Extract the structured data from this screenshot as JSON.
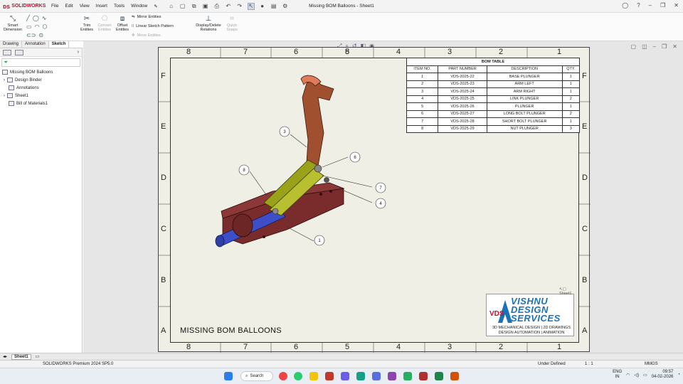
{
  "app": {
    "brand": "SOLIDWORKS",
    "doc_title": "Missing BOM Balloons - Sheet1"
  },
  "menu": [
    "File",
    "Edit",
    "View",
    "Insert",
    "Tools",
    "Window"
  ],
  "ribbon": {
    "smart_dimension": "Smart Dimension",
    "trim": "Trim Entities",
    "convert": "Convert Entities",
    "offset": "Offset Entities",
    "mirror": "Mirror Entities",
    "linear_pattern": "Linear Sketch Pattern",
    "move": "Move Entities",
    "display_delete": "Display/Delete Relations",
    "quick_snaps": "Quick Snaps"
  },
  "tabs": [
    "Drawing",
    "Annotation",
    "Sketch"
  ],
  "tree": {
    "root": "Missing BOM Balloons",
    "items": [
      "Design Binder",
      "Annotations",
      "Sheet1",
      "Bill of Materials1"
    ]
  },
  "sheet": {
    "cols_top": [
      "8",
      "7",
      "6",
      "5",
      "4",
      "3",
      "2",
      "1"
    ],
    "rows": [
      "F",
      "E",
      "D",
      "C",
      "B",
      "A"
    ],
    "title": "MISSING BOM BALLOONS",
    "sheet_label": "Sheet1"
  },
  "bom": {
    "title": "BOM TABLE",
    "headers": [
      "ITEM NO.",
      "PART NUMBER",
      "DESCRIPTION",
      "QTY."
    ],
    "rows": [
      [
        "1",
        "VDS-2025-22",
        "BASE PLUNGER",
        "1"
      ],
      [
        "2",
        "VDS-2025-23",
        "ARM LEFT",
        "1"
      ],
      [
        "3",
        "VDS-2025-24",
        "ARM RIGHT",
        "1"
      ],
      [
        "4",
        "VDS-2025-25",
        "LINK PLUNGER",
        "2"
      ],
      [
        "5",
        "VDS-2025-26",
        "PLUNGER",
        "1"
      ],
      [
        "6",
        "VDS-2025-27",
        "LONG BOLT PLUNGER",
        "2"
      ],
      [
        "7",
        "VDS-2025-28",
        "SHORT BOLT PLUNGER",
        "1"
      ],
      [
        "8",
        "VDS-2025-29",
        "NUT PLUNGER",
        "3"
      ]
    ]
  },
  "balloons": [
    "1",
    "3",
    "4",
    "6",
    "7",
    "8"
  ],
  "logo": {
    "name1": "VISHNU",
    "name2": "DESIGN",
    "name3": "SERVICES",
    "abbr": "VDS",
    "tag1": "3D MECHANICAL DESIGN | 2D DRAWINGS",
    "tag2": "DESIGN AUTOMATION | ANIMATION"
  },
  "sheet_tab": "Sheet1",
  "status": {
    "version": "SOLIDWORKS Premium 2024 SP5.0",
    "state": "Under Defined",
    "scale": "1 : 1",
    "units": "MMGS"
  },
  "taskbar": {
    "search": "Search",
    "lang1": "ENG",
    "lang2": "IN",
    "time": "09:57",
    "date": "04-02-2026"
  },
  "colors": {
    "accent": "#c8102e",
    "base": "#7a2b2b",
    "link": "#9aa21a",
    "plunger": "#3c4fc8",
    "arm": "#a0502e",
    "logo_blue": "#1a72b8"
  }
}
